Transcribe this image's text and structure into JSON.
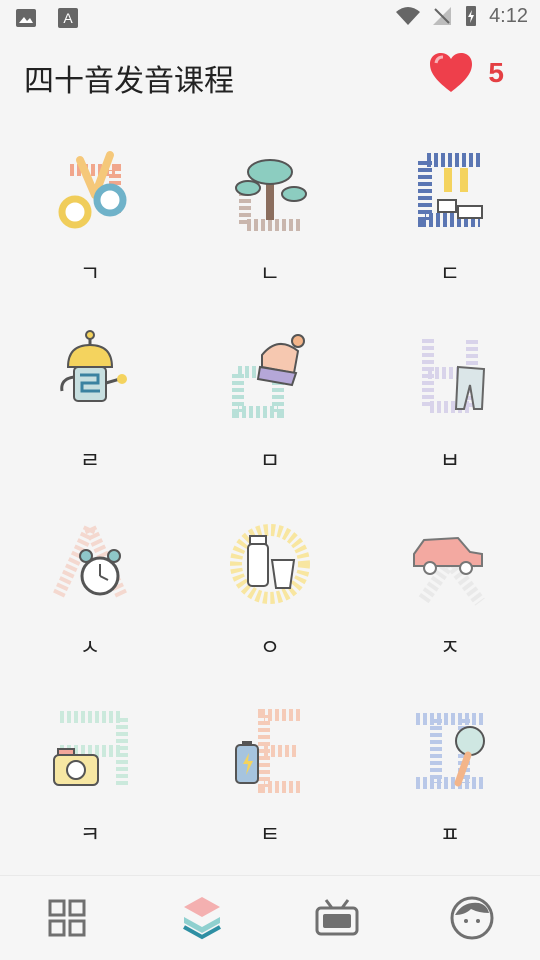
{
  "status": {
    "time": "4:12"
  },
  "header": {
    "title": "四十音发音课程",
    "lives": "5",
    "accent": "#e43f43"
  },
  "letters": [
    {
      "char": "ㄱ",
      "icon": "scissors-icon"
    },
    {
      "char": "ㄴ",
      "icon": "tree-icon"
    },
    {
      "char": "ㄷ",
      "icon": "feet-icon"
    },
    {
      "char": "ㄹ",
      "icon": "robot-icon"
    },
    {
      "char": "ㅁ",
      "icon": "hat-icon"
    },
    {
      "char": "ㅂ",
      "icon": "pants-icon"
    },
    {
      "char": "ㅅ",
      "icon": "clock-icon"
    },
    {
      "char": "ㅇ",
      "icon": "milk-icon"
    },
    {
      "char": "ㅈ",
      "icon": "car-icon"
    },
    {
      "char": "ㅋ",
      "icon": "camera-icon"
    },
    {
      "char": "ㅌ",
      "icon": "battery-icon"
    },
    {
      "char": "ㅍ",
      "icon": "rattle-icon"
    }
  ],
  "nav": [
    {
      "icon": "grid-icon",
      "active": false
    },
    {
      "icon": "layers-icon",
      "active": true
    },
    {
      "icon": "tv-icon",
      "active": false
    },
    {
      "icon": "profile-icon",
      "active": false
    }
  ]
}
